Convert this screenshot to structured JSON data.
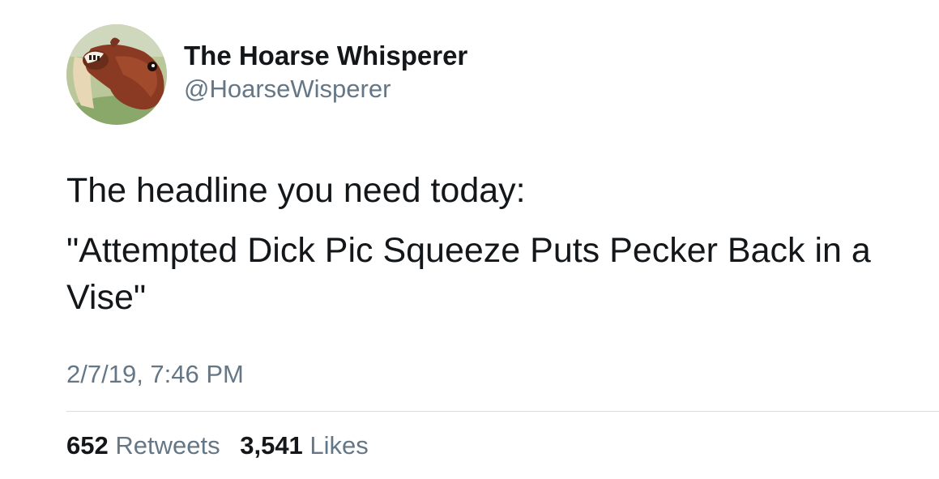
{
  "author": {
    "display_name": "The Hoarse Whisperer",
    "handle": "@HoarseWisperer",
    "avatar_icon": "horse-avatar"
  },
  "tweet": {
    "text_line1": "The headline you need today:",
    "text_line2": "\"Attempted Dick Pic Squeeze Puts Pecker Back in a Vise\"",
    "timestamp": "2/7/19, 7:46 PM"
  },
  "stats": {
    "retweets_count": "652",
    "retweets_label": "Retweets",
    "likes_count": "3,541",
    "likes_label": "Likes"
  },
  "colors": {
    "text_primary": "#14171a",
    "text_secondary": "#657786",
    "divider": "#d8dde1",
    "background": "#ffffff"
  }
}
